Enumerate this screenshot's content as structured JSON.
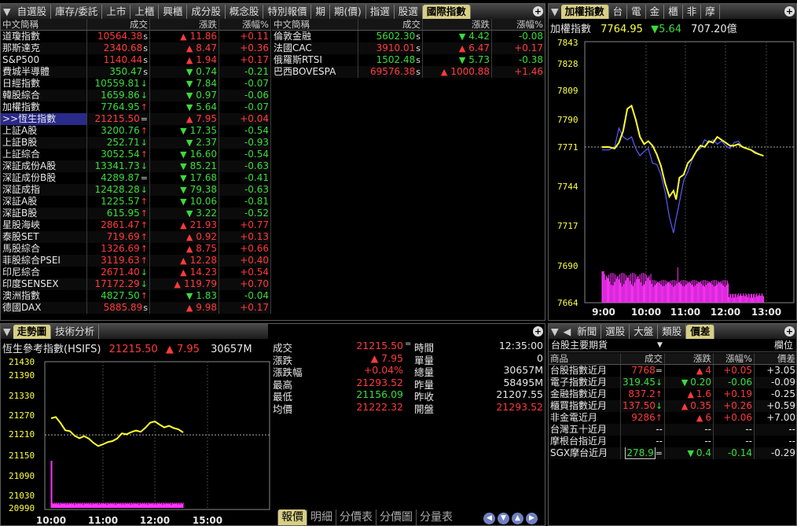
{
  "top_tabs": [
    "自選股",
    "庫存/委託",
    "上市",
    "上櫃",
    "興櫃",
    "成分股",
    "概念股",
    "特別報價",
    "期",
    "期(價)",
    "指選",
    "股選",
    "國際指數"
  ],
  "table_headers": [
    "中文簡稱",
    "成交",
    "漲跌",
    "漲幅%"
  ],
  "left_rows": [
    {
      "name": "道瓊指數",
      "price": "10564.38",
      "flag": "s",
      "dir": "up",
      "chg": "11.86",
      "pct": "+0.11"
    },
    {
      "name": "那斯達克",
      "price": "2340.68",
      "flag": "s",
      "dir": "up",
      "chg": "8.47",
      "pct": "+0.36"
    },
    {
      "name": "S&P500",
      "price": "1140.44",
      "flag": "s",
      "dir": "up",
      "chg": "1.94",
      "pct": "+0.17"
    },
    {
      "name": "費城半導體",
      "price": "350.47",
      "flag": "s",
      "dir": "down",
      "chg": "0.74",
      "pct": "-0.21"
    },
    {
      "name": "日經指數",
      "price": "10559.81",
      "flag": "↓",
      "dir": "down",
      "chg": "7.84",
      "pct": "-0.07"
    },
    {
      "name": "韓股綜合",
      "price": "1659.86",
      "flag": "↓",
      "dir": "down",
      "chg": "0.97",
      "pct": "-0.06"
    },
    {
      "name": "加權指數",
      "price": "7764.95",
      "flag": "↑",
      "dir": "down",
      "chg": "5.64",
      "pct": "-0.07"
    },
    {
      "name": ">>恆生指數",
      "price": "21215.50",
      "flag": "=",
      "dir": "up",
      "chg": "7.95",
      "pct": "+0.04"
    },
    {
      "name": "上証A股",
      "price": "3200.76",
      "flag": "↑",
      "dir": "down",
      "chg": "17.35",
      "pct": "-0.54"
    },
    {
      "name": "上証B股",
      "price": "252.71",
      "flag": "↓",
      "dir": "down",
      "chg": "2.37",
      "pct": "-0.93"
    },
    {
      "name": "上証綜合",
      "price": "3052.54",
      "flag": "↑",
      "dir": "down",
      "chg": "16.60",
      "pct": "-0.54"
    },
    {
      "name": "深証成份A股",
      "price": "13341.73",
      "flag": "↓",
      "dir": "down",
      "chg": "85.21",
      "pct": "-0.63"
    },
    {
      "name": "深証成份B股",
      "price": "4289.87",
      "flag": "=",
      "dir": "down",
      "chg": "17.68",
      "pct": "-0.41"
    },
    {
      "name": "深証成指",
      "price": "12428.28",
      "flag": "↓",
      "dir": "down",
      "chg": "79.38",
      "pct": "-0.63"
    },
    {
      "name": "深証A股",
      "price": "1225.57",
      "flag": "↑",
      "dir": "down",
      "chg": "10.06",
      "pct": "-0.81"
    },
    {
      "name": "深証B股",
      "price": "615.95",
      "flag": "↑",
      "dir": "down",
      "chg": "3.22",
      "pct": "-0.52"
    },
    {
      "name": "星股海峽",
      "price": "2861.47",
      "flag": "↑",
      "dir": "up",
      "chg": "21.93",
      "pct": "+0.77"
    },
    {
      "name": "泰股SET",
      "price": "719.69",
      "flag": "↑",
      "dir": "up",
      "chg": "0.92",
      "pct": "+0.13"
    },
    {
      "name": "馬股綜合",
      "price": "1326.69",
      "flag": "↑",
      "dir": "up",
      "chg": "8.75",
      "pct": "+0.66"
    },
    {
      "name": "菲股綜合PSEI",
      "price": "3119.63",
      "flag": "↑",
      "dir": "up",
      "chg": "12.28",
      "pct": "+0.40"
    },
    {
      "name": "印尼綜合",
      "price": "2671.40",
      "flag": "↓",
      "dir": "up",
      "chg": "14.23",
      "pct": "+0.54"
    },
    {
      "name": "印度SENSEX",
      "price": "17172.29",
      "flag": "↓",
      "dir": "up",
      "chg": "119.79",
      "pct": "+0.70"
    },
    {
      "name": "澳洲指數",
      "price": "4827.50",
      "flag": "↑",
      "dir": "down",
      "chg": "1.83",
      "pct": "-0.04"
    },
    {
      "name": "德國DAX",
      "price": "5885.89",
      "flag": "s",
      "dir": "up",
      "chg": "9.98",
      "pct": "+0.17"
    }
  ],
  "right_rows": [
    {
      "name": "倫敦金融",
      "price": "5602.30",
      "flag": "s",
      "dir": "down",
      "chg": "4.42",
      "pct": "-0.08"
    },
    {
      "name": "法國CAC",
      "price": "3910.01",
      "flag": "s",
      "dir": "up",
      "chg": "6.47",
      "pct": "+0.17"
    },
    {
      "name": "俄羅斯RTSI",
      "price": "1502.48",
      "flag": "s",
      "dir": "down",
      "chg": "5.73",
      "pct": "-0.38"
    },
    {
      "name": "巴西BOVESPA",
      "price": "69576.38",
      "flag": "s",
      "dir": "up",
      "chg": "1000.88",
      "pct": "+1.46"
    }
  ],
  "tr_tabs": [
    "加權指數",
    "台",
    "電",
    "金",
    "櫃",
    "非",
    "摩"
  ],
  "tr_info": {
    "name": "加權指數",
    "price": "7764.95",
    "chg": "5.64",
    "amount": "707.20億"
  },
  "tr_chart": {
    "yticks": [
      7843,
      7828,
      7809,
      7790,
      7771,
      7744,
      7717,
      7690,
      7664
    ],
    "xticks": [
      "9:00",
      "10:00",
      "11:00",
      "12:00",
      "13:00"
    ],
    "ref": 7771,
    "price": [
      [
        0,
        7771
      ],
      [
        8,
        7771
      ],
      [
        15,
        7770
      ],
      [
        20,
        7774
      ],
      [
        25,
        7782
      ],
      [
        30,
        7797
      ],
      [
        35,
        7799
      ],
      [
        40,
        7790
      ],
      [
        45,
        7778
      ],
      [
        50,
        7773
      ],
      [
        55,
        7775
      ],
      [
        60,
        7772
      ],
      [
        65,
        7766
      ],
      [
        70,
        7758
      ],
      [
        75,
        7746
      ],
      [
        80,
        7737
      ],
      [
        85,
        7741
      ],
      [
        88,
        7735
      ],
      [
        92,
        7750
      ],
      [
        97,
        7752
      ],
      [
        102,
        7760
      ],
      [
        107,
        7763
      ],
      [
        112,
        7768
      ],
      [
        117,
        7772
      ],
      [
        122,
        7771
      ],
      [
        127,
        7775
      ],
      [
        132,
        7774
      ],
      [
        137,
        7778
      ],
      [
        142,
        7776
      ],
      [
        147,
        7774
      ],
      [
        152,
        7772
      ],
      [
        157,
        7772
      ],
      [
        162,
        7773
      ],
      [
        167,
        7771
      ],
      [
        172,
        7770
      ],
      [
        177,
        7769
      ],
      [
        182,
        7767
      ],
      [
        187,
        7766
      ],
      [
        192,
        7764.95
      ]
    ],
    "avg": [
      [
        0,
        7769
      ],
      [
        8,
        7769
      ],
      [
        15,
        7771
      ],
      [
        20,
        7784
      ],
      [
        25,
        7778
      ],
      [
        30,
        7776
      ],
      [
        35,
        7778
      ],
      [
        40,
        7770
      ],
      [
        45,
        7765
      ],
      [
        50,
        7768
      ],
      [
        55,
        7770
      ],
      [
        60,
        7760
      ],
      [
        65,
        7759
      ],
      [
        70,
        7752
      ],
      [
        75,
        7740
      ],
      [
        80,
        7723
      ],
      [
        85,
        7712
      ],
      [
        88,
        7722
      ],
      [
        92,
        7733
      ],
      [
        97,
        7748
      ],
      [
        102,
        7754
      ],
      [
        107,
        7762
      ],
      [
        112,
        7768
      ],
      [
        117,
        7770
      ],
      [
        122,
        7776
      ],
      [
        127,
        7774
      ],
      [
        132,
        7776
      ],
      [
        137,
        7773
      ],
      [
        142,
        7775
      ],
      [
        147,
        7772
      ],
      [
        152,
        7770
      ],
      [
        157,
        7774
      ],
      [
        162,
        7775
      ],
      [
        167,
        7771
      ],
      [
        172,
        7770
      ],
      [
        177,
        7769
      ],
      [
        182,
        7768
      ],
      [
        187,
        7766
      ],
      [
        192,
        7765
      ]
    ]
  },
  "bl_tabs": [
    "走勢圖",
    "技術分析"
  ],
  "bl_header": {
    "name": "恆生參考指數(HSIFS)",
    "price": "21215.50",
    "chg": "7.95",
    "volume": "30657M"
  },
  "bl_chart": {
    "yticks": [
      21430,
      21390,
      21330,
      21270,
      21210,
      21150,
      21090,
      21030,
      20990
    ],
    "xticks": [
      "10:00",
      "11:00",
      "12:00",
      "15:00"
    ],
    "ref": 21207.55,
    "price": [
      [
        0,
        21260
      ],
      [
        3,
        21264
      ],
      [
        6,
        21245
      ],
      [
        9,
        21222
      ],
      [
        12,
        21219
      ],
      [
        15,
        21205
      ],
      [
        18,
        21198
      ],
      [
        21,
        21204
      ],
      [
        24,
        21197
      ],
      [
        27,
        21185
      ],
      [
        30,
        21176
      ],
      [
        33,
        21181
      ],
      [
        36,
        21187
      ],
      [
        39,
        21190
      ],
      [
        42,
        21197
      ],
      [
        45,
        21212
      ],
      [
        48,
        21209
      ],
      [
        51,
        21216
      ],
      [
        54,
        21221
      ],
      [
        57,
        21217
      ],
      [
        60,
        21230
      ],
      [
        63,
        21246
      ],
      [
        66,
        21250
      ],
      [
        69,
        21240
      ],
      [
        72,
        21231
      ],
      [
        75,
        21236
      ],
      [
        78,
        21229
      ],
      [
        81,
        21225
      ],
      [
        84,
        21215
      ]
    ]
  },
  "quote": {
    "rows": [
      {
        "l1": "成交",
        "v1": "21215.50",
        "t1": "=",
        "c1": "red",
        "l2": "時間",
        "v2": "12:35:00",
        "c2": "white"
      },
      {
        "l1": "漲跌",
        "v1": "▲ 7.95",
        "t1": "",
        "c1": "red",
        "l2": "單量",
        "v2": "0",
        "c2": "white"
      },
      {
        "l1": "漲跌幅",
        "v1": "+0.04%",
        "t1": "",
        "c1": "red",
        "l2": "總量",
        "v2": "30657M",
        "c2": "white"
      },
      {
        "l1": "最高",
        "v1": "21293.52",
        "t1": "",
        "c1": "red",
        "l2": "昨量",
        "v2": "58495M",
        "c2": "white"
      },
      {
        "l1": "最低",
        "v1": "21156.09",
        "t1": "",
        "c1": "green",
        "l2": "昨收",
        "v2": "21207.55",
        "c2": "white"
      },
      {
        "l1": "均價",
        "v1": "21222.32",
        "t1": "",
        "c1": "red",
        "l2": "開盤",
        "v2": "21293.52",
        "c2": "red"
      }
    ]
  },
  "bottom_tabs": [
    "報價",
    "明細",
    "分價表",
    "分價圖",
    "分量表"
  ],
  "br_tabs": [
    "新聞",
    "選股",
    "大盤",
    "類股",
    "價差"
  ],
  "br_select": "台股主要期貨",
  "br_select_right": "欄位",
  "br_headers": [
    "商品",
    "成交",
    "漲跌",
    "漲幅%",
    "價差"
  ],
  "br_rows": [
    {
      "name": "台股指數近月",
      "price": "7768",
      "flag": "=",
      "pc": "red",
      "dir": "up",
      "chg": "4",
      "pct": "+0.05",
      "spread": "+3.05"
    },
    {
      "name": "電子指數近月",
      "price": "319.45",
      "flag": "↓",
      "pc": "green",
      "dir": "down",
      "chg": "0.20",
      "pct": "-0.06",
      "spread": "-0.09"
    },
    {
      "name": "金融指數近月",
      "price": "837.2",
      "flag": "↑",
      "pc": "red",
      "dir": "up",
      "chg": "1.6",
      "pct": "+0.19",
      "spread": "-0.25"
    },
    {
      "name": "櫃買指數近月",
      "price": "137.50",
      "flag": "↓",
      "pc": "red",
      "dir": "up",
      "chg": "0.35",
      "pct": "+0.26",
      "spread": "+0.59"
    },
    {
      "name": "非金電近月",
      "price": "9286",
      "flag": "↑",
      "pc": "red",
      "dir": "up",
      "chg": "6",
      "pct": "+0.06",
      "spread": "+7.00"
    },
    {
      "name": "台灣五十近月",
      "price": "--",
      "flag": "",
      "pc": "white",
      "dir": "",
      "chg": "--",
      "pct": "--",
      "spread": "--"
    },
    {
      "name": "摩根台指近月",
      "price": "--",
      "flag": "",
      "pc": "white",
      "dir": "",
      "chg": "--",
      "pct": "--",
      "spread": "--"
    },
    {
      "name": "SGX摩台近月",
      "price": "278.9",
      "flag": "=",
      "pc": "green",
      "dir": "down",
      "chg": "0.4",
      "pct": "-0.14",
      "spread": "-0.29"
    }
  ]
}
